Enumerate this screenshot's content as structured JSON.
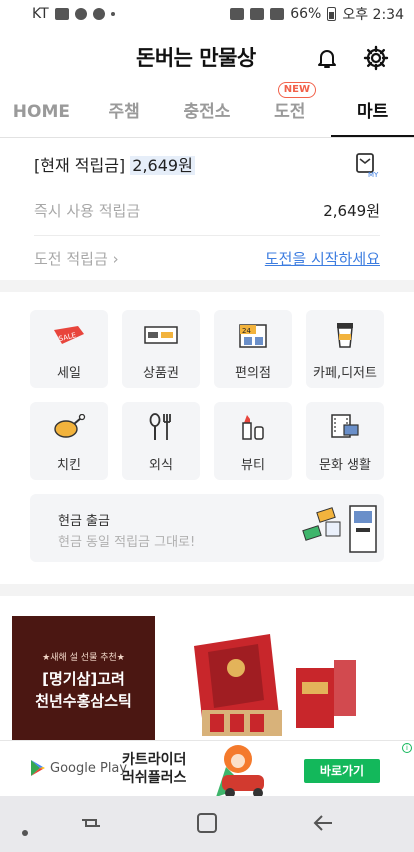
{
  "status_bar": {
    "carrier": "KT",
    "battery": "66%",
    "time": "오후 2:34"
  },
  "header": {
    "title": "돈버는 만물상",
    "icons": [
      "bell-icon",
      "gear-icon"
    ]
  },
  "tabs": [
    {
      "label": "HOME",
      "active": false
    },
    {
      "label": "주챔",
      "active": false
    },
    {
      "label": "충전소",
      "active": false
    },
    {
      "label": "도전",
      "active": false,
      "badge": "NEW"
    },
    {
      "label": "마트",
      "active": true
    }
  ],
  "points": {
    "current_label": "[현재 적립금]",
    "current_value": "2,649원",
    "my_badge": "MY",
    "instant_label": "즉시 사용 적립금",
    "instant_value": "2,649원",
    "challenge_label": "도전 적립금",
    "challenge_link": "도전을 시작하세요"
  },
  "categories": [
    {
      "label": "세일",
      "icon": "sale-tag-icon",
      "icon_text": "SALE"
    },
    {
      "label": "상품권",
      "icon": "gift-card-icon"
    },
    {
      "label": "편의점",
      "icon": "convenience-store-icon",
      "icon_text": "24"
    },
    {
      "label": "카페,디저트",
      "icon": "coffee-cup-icon"
    },
    {
      "label": "치킨",
      "icon": "chicken-icon"
    },
    {
      "label": "외식",
      "icon": "fork-spoon-icon"
    },
    {
      "label": "뷰티",
      "icon": "lipstick-icon"
    },
    {
      "label": "문화 생활",
      "icon": "film-ticket-icon"
    }
  ],
  "cash_out": {
    "title": "현금 출금",
    "subtitle": "현금 동일 적립금 그대로!"
  },
  "promo": {
    "subtitle": "★새해 설 선물 추천★",
    "title_line1": "[명기삼]고려",
    "title_line2": "천년수홍삼스틱"
  },
  "ad": {
    "store": "Google Play",
    "copy_line1": "카트라이더",
    "copy_line2": "러쉬플러스",
    "button": "바로가기",
    "info": "i",
    "accent": "#13b85b"
  },
  "colors": {
    "link": "#3d7de0",
    "new_badge": "#f2624b",
    "promo_bg": "#4b1712"
  }
}
